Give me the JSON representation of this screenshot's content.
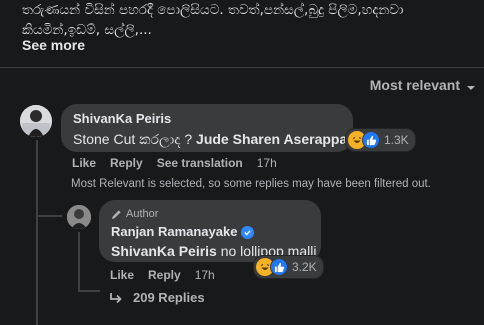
{
  "post": {
    "text": "තරුණයන් විසින් පහරදී පොලිසියට. තවත්,පන්සල්,බුදු පිලිම,හදනවා කියමින්,ඉඩම්, සල්ලි,...",
    "see_more_label": "See more"
  },
  "sort": {
    "label": "Most relevant",
    "icon": "chevron-down-icon"
  },
  "comment": {
    "author": "ShivanKa Peiris",
    "text_prefix": "Stone Cut කරලාද ? ",
    "mention": "Jude Sharen Aserappa",
    "reaction_count": "1.3K",
    "reactions": [
      "haha-reaction-icon",
      "like-reaction-icon"
    ],
    "like_label": "Like",
    "reply_label": "Reply",
    "translate_label": "See translation",
    "time": "17h",
    "filter_note": "Most Relevant is selected, so some replies may have been filtered out."
  },
  "reply": {
    "badge": "Author",
    "author": "Ranjan Ramanayake",
    "mention": "ShivanKa Peiris",
    "text": " no lollipop malli",
    "reaction_count": "3.2K",
    "reactions": [
      "haha-reaction-icon",
      "like-reaction-icon"
    ],
    "like_label": "Like",
    "reply_label": "Reply",
    "time": "17h"
  },
  "replies_link": {
    "label": "209 Replies",
    "icon": "reply-arrow-icon"
  },
  "colors": {
    "background": "#18191a",
    "bubble": "#3a3b3c",
    "primary_text": "#e4e6eb",
    "secondary_text": "#b0b3b8",
    "like_blue": "#2078f4",
    "haha_yellow": "#f7b125",
    "verified_blue": "#2e89ff"
  }
}
